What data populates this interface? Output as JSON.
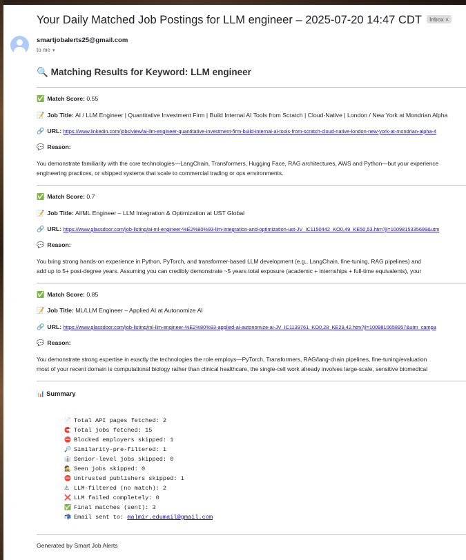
{
  "email": {
    "subject": "Your Daily Matched Job Postings for LLM engineer – 2025-07-20 14:47 CDT",
    "label": "Inbox",
    "label_close": "×",
    "sender": "smartjobalerts25@gmail.com",
    "recipient": "to me",
    "recipient_caret": "▾"
  },
  "results": {
    "heading_icon": "🔍",
    "heading": "Matching Results for Keyword: LLM engineer",
    "match_score_label": "Match Score:",
    "job_title_label": "Job Title:",
    "url_label": "URL:",
    "reason_label": "Reason:",
    "icons": {
      "score": "✅",
      "title": "📝",
      "url": "🔗",
      "reason": "💬"
    },
    "jobs": [
      {
        "score": "0.55",
        "title": "AI / LLM Engineer | Quantitative Investment Firm | Build Internal AI Tools from Scratch | Cloud-Native | London / New York at Mondrian Alpha",
        "url": "https://www.linkedin.com/jobs/view/ai-llm-engineer-quantitative-investment-firm-build-internal-ai-tools-from-scratch-cloud-native-london-new-york-at-mondrian-alpha-4",
        "reason_line1": "You demonstrate familiarity with the core technologies—LangChain, Transformers, Hugging Face, RAG architectures, AWS and Python—but your experience",
        "reason_line2": "engineering practices, or shipped systems that scale to commercial trading or ops environments."
      },
      {
        "score": "0.7",
        "title": "AI/ML Engineer – LLM Integration & Optimization at UST Global",
        "url": "https://www.glassdoor.com/job-listing/ai-ml-engineer-%E2%80%93-llm-integration-and-optimization-ust-JV_IC1150442_KO0,49_KE50,53.htm?jl=1009815335699&utm",
        "reason_line1": "You bring strong hands-on experience in Python, PyTorch, and transformer-based LLM development (e.g., LangChain, fine-tuning, RAG pipelines) and",
        "reason_line2": "add up to 5+ post-degree years. Assuming you can credibly demonstrate ~5 years total exposure (academic + internships + full-time equivalents), your"
      },
      {
        "score": "0.85",
        "title": "ML/LLM Engineer – Applied AI at Autonomize AI",
        "url": "https://www.glassdoor.com/job-listing/ml-llm-engineer-%E2%80%93-applied-ai-autonomize-ai-JV_IC1139761_KO0,28_KE29,42.htm?jl=1009810658957&utm_campa",
        "reason_line1": "You demonstrate strong expertise in exactly the technologies the role employs—PyTorch, Transformers, RAG/lang-chain pipelines, fine-tuning/evaluation",
        "reason_line2": "most of your recent domain is computational biology rather than clinical healthcare, the single-cell work already involves large-scale, sensitive biomedical"
      }
    ]
  },
  "summary": {
    "icon": "📊",
    "title": "Summary",
    "items": [
      {
        "icon": "📄",
        "text": "Total API pages fetched: 2"
      },
      {
        "icon": "🧲",
        "text": "Total jobs fetched: 15"
      },
      {
        "icon": "⛔",
        "text": "Blocked employers skipped: 1"
      },
      {
        "icon": "🔎",
        "text": "Similarity-pre-filtered: 1"
      },
      {
        "icon": "👔",
        "text": "Senior-level jobs skipped: 0"
      },
      {
        "icon": "🕵",
        "text": "Seen jobs skipped: 0"
      },
      {
        "icon": "⛔",
        "text": "Untrusted publishers skipped: 1"
      },
      {
        "icon": "⚠",
        "text": "LLM-filtered (no match): 2"
      },
      {
        "icon": "❌",
        "text": "LLM failed completely: 0"
      },
      {
        "icon": "✅",
        "text": "Final matches (sent): 3"
      }
    ],
    "email_item": {
      "icon": "📬",
      "label": "Email sent to: ",
      "address": "malmir.edumail@gmail.com"
    }
  },
  "footer": "Generated by Smart Job Alerts",
  "colors": {
    "link": "#1a0dab",
    "avatar": "#aecbfa",
    "divider": "#bbbbbb"
  }
}
